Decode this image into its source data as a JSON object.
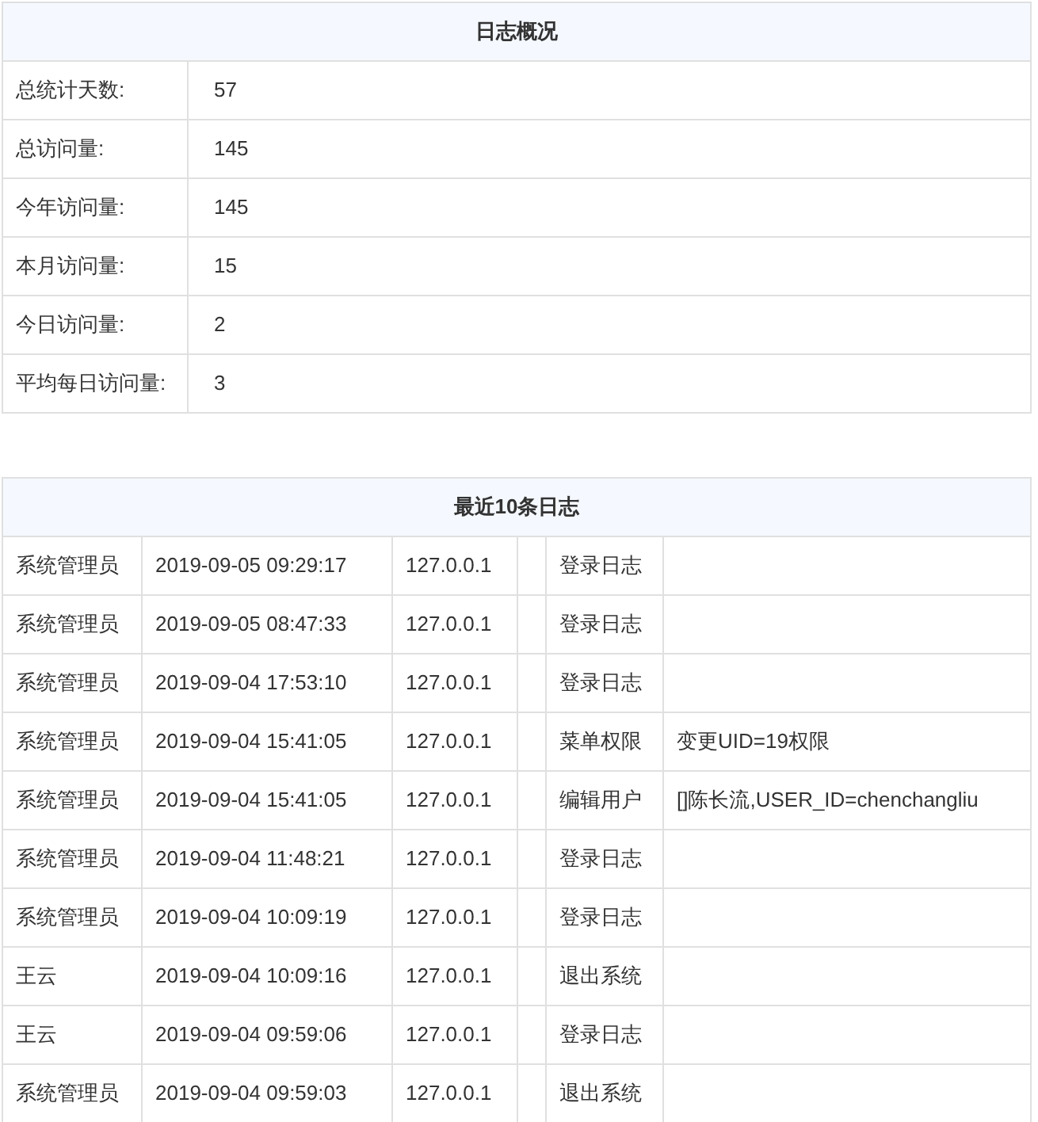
{
  "overview": {
    "title": "日志概况",
    "rows": [
      {
        "label": "总统计天数:",
        "value": "57"
      },
      {
        "label": "总访问量:",
        "value": "145"
      },
      {
        "label": "今年访问量:",
        "value": "145"
      },
      {
        "label": "本月访问量:",
        "value": "15"
      },
      {
        "label": "今日访问量:",
        "value": "2"
      },
      {
        "label": "平均每日访问量:",
        "value": "3"
      }
    ]
  },
  "recent_logs": {
    "title": "最近10条日志",
    "rows": [
      {
        "user": "系统管理员",
        "time": "2019-09-05 09:29:17",
        "ip": "127.0.0.1",
        "action": "登录日志"
      },
      {
        "user": "系统管理员",
        "time": "2019-09-05 08:47:33",
        "ip": "127.0.0.1",
        "action": "登录日志"
      },
      {
        "user": "系统管理员",
        "time": "2019-09-04 17:53:10",
        "ip": "127.0.0.1",
        "action": "登录日志"
      },
      {
        "user": "系统管理员",
        "time": "2019-09-04 15:41:05",
        "ip": "127.0.0.1",
        "action": "菜单权限",
        "detail": "变更UID=19权限"
      },
      {
        "user": "系统管理员",
        "time": "2019-09-04 15:41:05",
        "ip": "127.0.0.1",
        "action": "编辑用户",
        "detail": "[]陈长流,USER_ID=chenchangliu"
      },
      {
        "user": "系统管理员",
        "time": "2019-09-04 11:48:21",
        "ip": "127.0.0.1",
        "action": "登录日志"
      },
      {
        "user": "系统管理员",
        "time": "2019-09-04 10:09:19",
        "ip": "127.0.0.1",
        "action": "登录日志"
      },
      {
        "user": "王云",
        "time": "2019-09-04 10:09:16",
        "ip": "127.0.0.1",
        "action": "退出系统"
      },
      {
        "user": "王云",
        "time": "2019-09-04 09:59:06",
        "ip": "127.0.0.1",
        "action": "登录日志"
      },
      {
        "user": "系统管理员",
        "time": "2019-09-04 09:59:03",
        "ip": "127.0.0.1",
        "action": "退出系统"
      }
    ]
  }
}
